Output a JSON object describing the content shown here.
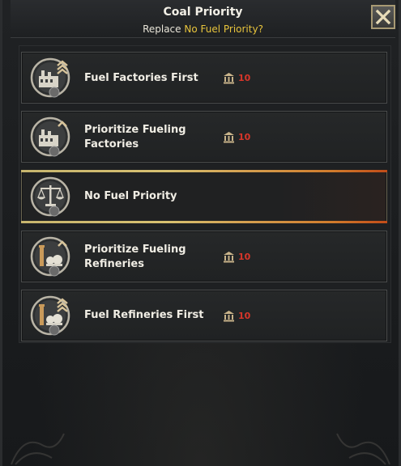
{
  "header": {
    "title": "Coal Priority",
    "subtitle_prefix": "Replace ",
    "subtitle_highlight": "No Fuel Priority?"
  },
  "options": [
    {
      "label": "Fuel Factories First",
      "cost": "10",
      "icon": "factory-up-icon",
      "selected": false
    },
    {
      "label": "Prioritize Fueling Factories",
      "cost": "10",
      "icon": "factory-up-small-icon",
      "selected": false
    },
    {
      "label": "No Fuel Priority",
      "cost": "",
      "icon": "balance-scale-icon",
      "selected": true
    },
    {
      "label": "Prioritize Fueling Refineries",
      "cost": "10",
      "icon": "refinery-small-icon",
      "selected": false
    },
    {
      "label": "Fuel Refineries First",
      "cost": "10",
      "icon": "refinery-up-icon",
      "selected": false
    }
  ],
  "colors": {
    "highlight": "#e8c43c",
    "cost_text": "#d8362a",
    "selected_border_start": "#d7c070",
    "selected_border_end": "#c24c18"
  }
}
